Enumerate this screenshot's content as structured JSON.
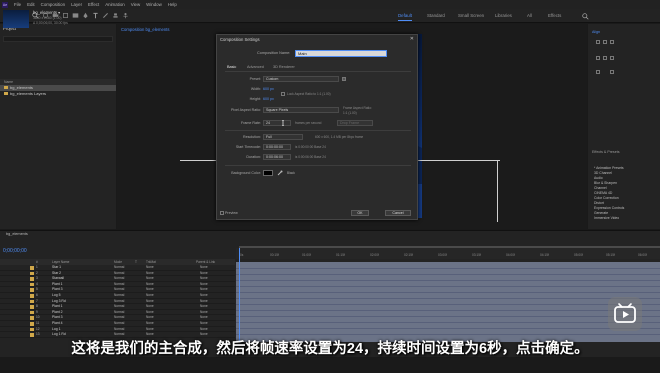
{
  "menu": {
    "items": [
      "File",
      "Edit",
      "Composition",
      "Layer",
      "Effect",
      "Animation",
      "View",
      "Window",
      "Help"
    ]
  },
  "workspaces": [
    {
      "label": "Default",
      "active": true
    },
    {
      "label": "Standard",
      "active": false
    },
    {
      "label": "Small Screen",
      "active": false
    },
    {
      "label": "Libraries",
      "active": false
    },
    {
      "label": "All",
      "active": false
    },
    {
      "label": "Effects",
      "active": false
    }
  ],
  "project": {
    "tab": "Project",
    "item_name": "bg_elements ▾",
    "item_size": "3840 x 2160 (1.00)",
    "item_duration": "Δ 0;00;06;00, 30.00 fps",
    "list_header": "Name",
    "rows": [
      {
        "name": "bg_elements",
        "selected": true,
        "color": "#d0a84a"
      },
      {
        "name": "bg_elements Layers",
        "selected": false,
        "color": "#d0a84a"
      }
    ]
  },
  "viewer": {
    "tab": "Composition bg_elements"
  },
  "right_panel": {
    "top_tab": "Align",
    "bottom_tab": "Effects & Presets",
    "effects": [
      "* Animation Presets",
      "3D Channel",
      "Audio",
      "Blur & Sharpen",
      "Channel",
      "CINEMA 4D",
      "Color Correction",
      "Distort",
      "Expression Controls",
      "Generate",
      "Immersive Video"
    ]
  },
  "dialog": {
    "title": "Composition Settings",
    "close_glyph": "✕",
    "name_label": "Composition Name:",
    "name_value": "Main",
    "tabs": [
      "Basic",
      "Advanced",
      "3D Renderer"
    ],
    "preset_label": "Preset:",
    "preset_value": "Custom",
    "width_label": "Width:",
    "width_value": "600 px",
    "lock_label": "Lock Aspect Ratio to 1:1 (1.00)",
    "height_label": "Height:",
    "height_value": "600 px",
    "par_label": "Pixel Aspect Ratio:",
    "par_value": "Square Pixels",
    "frame_aspect_label": "Frame Aspect Ratio:",
    "frame_aspect_value": "1:1 (1.00)",
    "fps_label": "Frame Rate:",
    "fps_value": "24",
    "fps_unit": "frames per second",
    "drop_frame": "Drop Frame",
    "resolution_label": "Resolution:",
    "resolution_value": "Full",
    "resolution_info": "600 x 600, 1.4 MB per 8bpc frame",
    "start_label": "Start Timecode:",
    "start_value": "0:00:00:00",
    "start_info": "is 0:00:00:00 Base 24",
    "duration_label": "Duration:",
    "duration_value": "0:00:06:00",
    "duration_info": "is 0:00:06:00 Base 24",
    "bg_label": "Background Color:",
    "bg_name": "Black",
    "preview_label": "Preview",
    "ok_label": "OK",
    "cancel_label": "Cancel"
  },
  "timeline": {
    "tab": "bg_elements",
    "time": "0;00;00;00",
    "columns": [
      "#",
      "Layer Name",
      "Mode",
      "T",
      "TrkMat",
      "Parent & Link"
    ],
    "ruler_ticks": [
      "0s",
      "00:15f",
      "01:00f",
      "01:15f",
      "02:00f",
      "02:15f",
      "03:00f",
      "03:15f",
      "04:00f",
      "04:15f",
      "05:00f",
      "05:15f",
      "06:00f"
    ],
    "layers": [
      {
        "num": "1",
        "name": "Star 1",
        "mode": "Normal",
        "trk": "None",
        "parent": "None"
      },
      {
        "num": "2",
        "name": "Star 2",
        "mode": "Normal",
        "trk": "None",
        "parent": "None"
      },
      {
        "num": "3",
        "name": "Starwall",
        "mode": "Normal",
        "trk": "None",
        "parent": "None"
      },
      {
        "num": "4",
        "name": "Plant 1",
        "mode": "Normal",
        "trk": "None",
        "parent": "None"
      },
      {
        "num": "5",
        "name": "Plant 3",
        "mode": "Normal",
        "trk": "None",
        "parent": "None"
      },
      {
        "num": "6",
        "name": "Log 5",
        "mode": "Normal",
        "trk": "None",
        "parent": "None"
      },
      {
        "num": "7",
        "name": "Log 3 Rd",
        "mode": "Normal",
        "trk": "None",
        "parent": "None"
      },
      {
        "num": "8",
        "name": "Plant 1",
        "mode": "Normal",
        "trk": "None",
        "parent": "None"
      },
      {
        "num": "9",
        "name": "Plant 2",
        "mode": "Normal",
        "trk": "None",
        "parent": "None"
      },
      {
        "num": "10",
        "name": "Plant 3",
        "mode": "Normal",
        "trk": "None",
        "parent": "None"
      },
      {
        "num": "11",
        "name": "Plant 4",
        "mode": "Normal",
        "trk": "None",
        "parent": "None"
      },
      {
        "num": "12",
        "name": "Log 1",
        "mode": "Normal",
        "trk": "None",
        "parent": "None"
      },
      {
        "num": "13",
        "name": "Log 1 Rd",
        "mode": "Normal",
        "trk": "None",
        "parent": "None"
      }
    ]
  },
  "subtitle": "这将是我们的主合成，然后将帧速率设置为24，持续时间设置为6秒，点击确定。",
  "colors": {
    "accent": "#4f8df5",
    "track": "#6b7387",
    "label_orange": "#d0a84a"
  }
}
